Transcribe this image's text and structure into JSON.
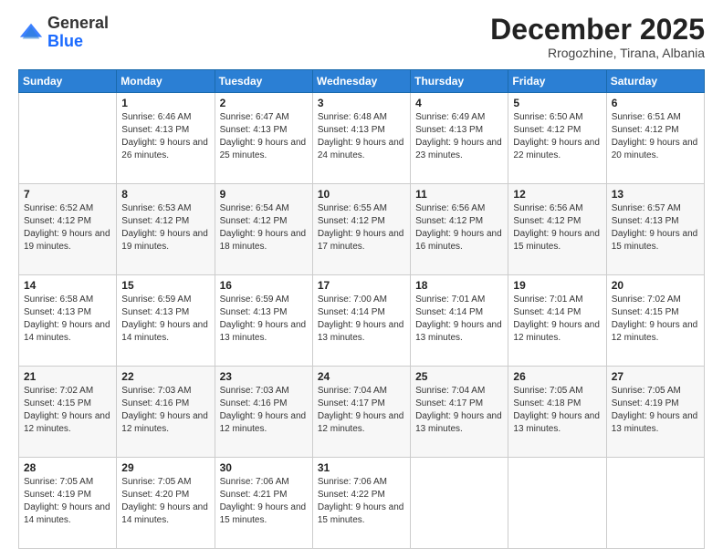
{
  "header": {
    "logo_general": "General",
    "logo_blue": "Blue",
    "month": "December 2025",
    "location": "Rrogozhine, Tirana, Albania"
  },
  "weekdays": [
    "Sunday",
    "Monday",
    "Tuesday",
    "Wednesday",
    "Thursday",
    "Friday",
    "Saturday"
  ],
  "weeks": [
    [
      {
        "day": "",
        "sunrise": "",
        "sunset": "",
        "daylight": ""
      },
      {
        "day": "1",
        "sunrise": "Sunrise: 6:46 AM",
        "sunset": "Sunset: 4:13 PM",
        "daylight": "Daylight: 9 hours and 26 minutes."
      },
      {
        "day": "2",
        "sunrise": "Sunrise: 6:47 AM",
        "sunset": "Sunset: 4:13 PM",
        "daylight": "Daylight: 9 hours and 25 minutes."
      },
      {
        "day": "3",
        "sunrise": "Sunrise: 6:48 AM",
        "sunset": "Sunset: 4:13 PM",
        "daylight": "Daylight: 9 hours and 24 minutes."
      },
      {
        "day": "4",
        "sunrise": "Sunrise: 6:49 AM",
        "sunset": "Sunset: 4:13 PM",
        "daylight": "Daylight: 9 hours and 23 minutes."
      },
      {
        "day": "5",
        "sunrise": "Sunrise: 6:50 AM",
        "sunset": "Sunset: 4:12 PM",
        "daylight": "Daylight: 9 hours and 22 minutes."
      },
      {
        "day": "6",
        "sunrise": "Sunrise: 6:51 AM",
        "sunset": "Sunset: 4:12 PM",
        "daylight": "Daylight: 9 hours and 20 minutes."
      }
    ],
    [
      {
        "day": "7",
        "sunrise": "Sunrise: 6:52 AM",
        "sunset": "Sunset: 4:12 PM",
        "daylight": "Daylight: 9 hours and 19 minutes."
      },
      {
        "day": "8",
        "sunrise": "Sunrise: 6:53 AM",
        "sunset": "Sunset: 4:12 PM",
        "daylight": "Daylight: 9 hours and 19 minutes."
      },
      {
        "day": "9",
        "sunrise": "Sunrise: 6:54 AM",
        "sunset": "Sunset: 4:12 PM",
        "daylight": "Daylight: 9 hours and 18 minutes."
      },
      {
        "day": "10",
        "sunrise": "Sunrise: 6:55 AM",
        "sunset": "Sunset: 4:12 PM",
        "daylight": "Daylight: 9 hours and 17 minutes."
      },
      {
        "day": "11",
        "sunrise": "Sunrise: 6:56 AM",
        "sunset": "Sunset: 4:12 PM",
        "daylight": "Daylight: 9 hours and 16 minutes."
      },
      {
        "day": "12",
        "sunrise": "Sunrise: 6:56 AM",
        "sunset": "Sunset: 4:12 PM",
        "daylight": "Daylight: 9 hours and 15 minutes."
      },
      {
        "day": "13",
        "sunrise": "Sunrise: 6:57 AM",
        "sunset": "Sunset: 4:13 PM",
        "daylight": "Daylight: 9 hours and 15 minutes."
      }
    ],
    [
      {
        "day": "14",
        "sunrise": "Sunrise: 6:58 AM",
        "sunset": "Sunset: 4:13 PM",
        "daylight": "Daylight: 9 hours and 14 minutes."
      },
      {
        "day": "15",
        "sunrise": "Sunrise: 6:59 AM",
        "sunset": "Sunset: 4:13 PM",
        "daylight": "Daylight: 9 hours and 14 minutes."
      },
      {
        "day": "16",
        "sunrise": "Sunrise: 6:59 AM",
        "sunset": "Sunset: 4:13 PM",
        "daylight": "Daylight: 9 hours and 13 minutes."
      },
      {
        "day": "17",
        "sunrise": "Sunrise: 7:00 AM",
        "sunset": "Sunset: 4:14 PM",
        "daylight": "Daylight: 9 hours and 13 minutes."
      },
      {
        "day": "18",
        "sunrise": "Sunrise: 7:01 AM",
        "sunset": "Sunset: 4:14 PM",
        "daylight": "Daylight: 9 hours and 13 minutes."
      },
      {
        "day": "19",
        "sunrise": "Sunrise: 7:01 AM",
        "sunset": "Sunset: 4:14 PM",
        "daylight": "Daylight: 9 hours and 12 minutes."
      },
      {
        "day": "20",
        "sunrise": "Sunrise: 7:02 AM",
        "sunset": "Sunset: 4:15 PM",
        "daylight": "Daylight: 9 hours and 12 minutes."
      }
    ],
    [
      {
        "day": "21",
        "sunrise": "Sunrise: 7:02 AM",
        "sunset": "Sunset: 4:15 PM",
        "daylight": "Daylight: 9 hours and 12 minutes."
      },
      {
        "day": "22",
        "sunrise": "Sunrise: 7:03 AM",
        "sunset": "Sunset: 4:16 PM",
        "daylight": "Daylight: 9 hours and 12 minutes."
      },
      {
        "day": "23",
        "sunrise": "Sunrise: 7:03 AM",
        "sunset": "Sunset: 4:16 PM",
        "daylight": "Daylight: 9 hours and 12 minutes."
      },
      {
        "day": "24",
        "sunrise": "Sunrise: 7:04 AM",
        "sunset": "Sunset: 4:17 PM",
        "daylight": "Daylight: 9 hours and 12 minutes."
      },
      {
        "day": "25",
        "sunrise": "Sunrise: 7:04 AM",
        "sunset": "Sunset: 4:17 PM",
        "daylight": "Daylight: 9 hours and 13 minutes."
      },
      {
        "day": "26",
        "sunrise": "Sunrise: 7:05 AM",
        "sunset": "Sunset: 4:18 PM",
        "daylight": "Daylight: 9 hours and 13 minutes."
      },
      {
        "day": "27",
        "sunrise": "Sunrise: 7:05 AM",
        "sunset": "Sunset: 4:19 PM",
        "daylight": "Daylight: 9 hours and 13 minutes."
      }
    ],
    [
      {
        "day": "28",
        "sunrise": "Sunrise: 7:05 AM",
        "sunset": "Sunset: 4:19 PM",
        "daylight": "Daylight: 9 hours and 14 minutes."
      },
      {
        "day": "29",
        "sunrise": "Sunrise: 7:05 AM",
        "sunset": "Sunset: 4:20 PM",
        "daylight": "Daylight: 9 hours and 14 minutes."
      },
      {
        "day": "30",
        "sunrise": "Sunrise: 7:06 AM",
        "sunset": "Sunset: 4:21 PM",
        "daylight": "Daylight: 9 hours and 15 minutes."
      },
      {
        "day": "31",
        "sunrise": "Sunrise: 7:06 AM",
        "sunset": "Sunset: 4:22 PM",
        "daylight": "Daylight: 9 hours and 15 minutes."
      },
      {
        "day": "",
        "sunrise": "",
        "sunset": "",
        "daylight": ""
      },
      {
        "day": "",
        "sunrise": "",
        "sunset": "",
        "daylight": ""
      },
      {
        "day": "",
        "sunrise": "",
        "sunset": "",
        "daylight": ""
      }
    ]
  ]
}
